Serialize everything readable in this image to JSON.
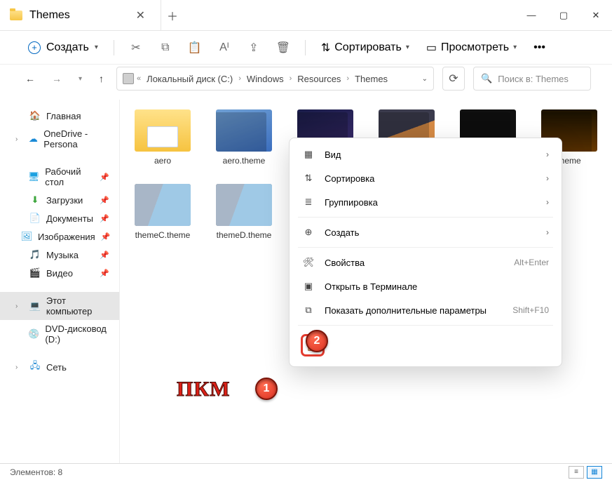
{
  "tab": {
    "title": "Themes"
  },
  "toolbar": {
    "new_label": "Создать",
    "sort_label": "Сортировать",
    "view_label": "Просмотреть"
  },
  "breadcrumb": {
    "items": [
      "Локальный диск (C:)",
      "Windows",
      "Resources",
      "Themes"
    ]
  },
  "search": {
    "placeholder": "Поиск в: Themes"
  },
  "sidebar": {
    "home": "Главная",
    "onedrive": "OneDrive - Persona",
    "desktop": "Рабочий стол",
    "downloads": "Загрузки",
    "documents": "Документы",
    "pictures": "Изображения",
    "music": "Музыка",
    "videos": "Видео",
    "thispc": "Этот компьютер",
    "dvd": "DVD-дисковод (D:)",
    "network": "Сеть"
  },
  "files": [
    {
      "name": "aero",
      "kind": "folder"
    },
    {
      "name": "aero.theme",
      "kind": "blue"
    },
    {
      "name": "",
      "kind": "dark"
    },
    {
      "name": "",
      "kind": "sun"
    },
    {
      "name": "",
      "kind": "glow"
    },
    {
      "name": "theme",
      "kind": "fire"
    },
    {
      "name": "themeC.theme",
      "kind": "sky"
    },
    {
      "name": "themeD.theme",
      "kind": "sky"
    }
  ],
  "context": {
    "view": "Вид",
    "sort": "Сортировка",
    "group": "Группировка",
    "new": "Создать",
    "props": "Свойства",
    "props_key": "Alt+Enter",
    "terminal": "Открыть в Терминале",
    "more": "Показать дополнительные параметры",
    "more_key": "Shift+F10"
  },
  "annot": {
    "pkm": "ПКМ",
    "n1": "1",
    "n2": "2"
  },
  "status": {
    "count_label": "Элементов: 8"
  }
}
